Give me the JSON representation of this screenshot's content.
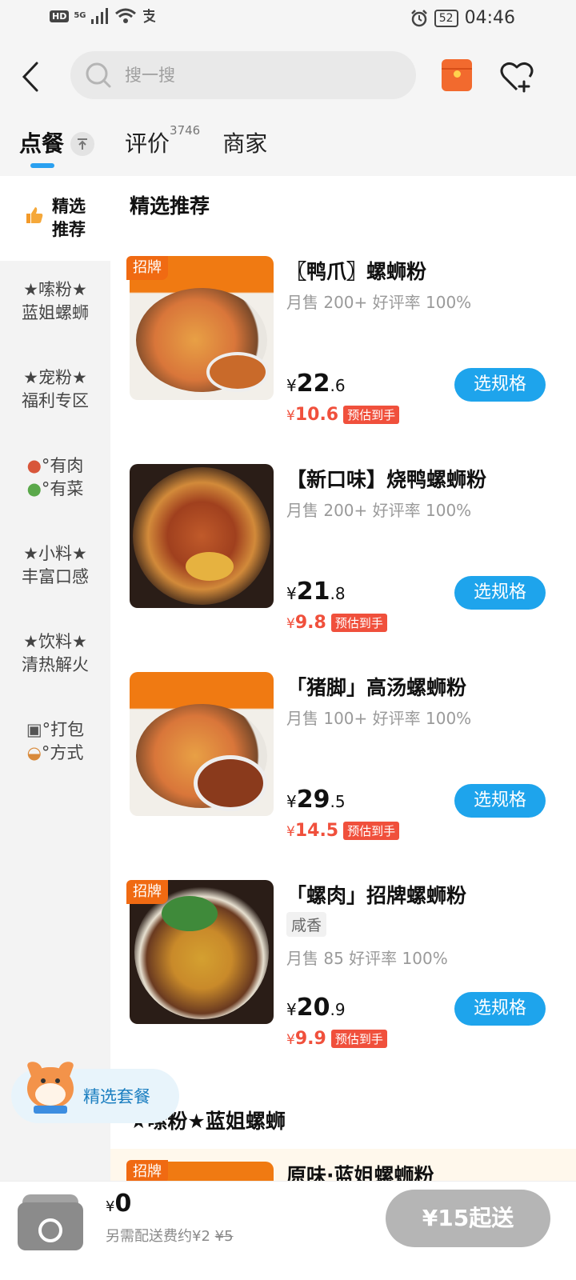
{
  "status_bar": {
    "hd": "HD",
    "network": "5G",
    "battery": "52",
    "time": "04:46"
  },
  "header": {
    "search_placeholder": "搜一搜",
    "tabs": [
      {
        "label": "点餐",
        "active": true
      },
      {
        "label": "评价",
        "count": "3746"
      },
      {
        "label": "商家"
      }
    ]
  },
  "sidebar": {
    "items": [
      {
        "line1": "精选",
        "line2": "推荐",
        "active": true,
        "icon": "thumbs-up-icon"
      },
      {
        "line1": "★嗦粉★",
        "line2": "蓝姐螺蛳"
      },
      {
        "line1": "★宠粉★",
        "line2": "福利专区"
      },
      {
        "line1": "°有肉",
        "line2": "°有菜",
        "icon": "meat-veg-icon"
      },
      {
        "line1": "★小料★",
        "line2": "丰富口感"
      },
      {
        "line1": "★饮料★",
        "line2": "清热解火"
      },
      {
        "line1": "°打包",
        "line2": "°方式",
        "icon": "package-icon"
      }
    ]
  },
  "main": {
    "section1_title": "精选推荐",
    "section2_title": "★嗦粉★蓝姐螺蛳",
    "badge_label": "招牌",
    "spec_button_label": "选规格",
    "est_label": "预估到手",
    "currency": "¥",
    "items": [
      {
        "name": "〖鸭爪〗螺蛳粉",
        "sales": "月售 200+ 好评率 100%",
        "price_int": "22",
        "price_dec": ".6",
        "est": "10.6",
        "badge": true
      },
      {
        "name": "【新口味】烧鸭螺蛳粉",
        "sales": "月售 200+ 好评率 100%",
        "price_int": "21",
        "price_dec": ".8",
        "est": "9.8",
        "badge": false
      },
      {
        "name": "「猪脚」高汤螺蛳粉",
        "sales": "月售 100+ 好评率 100%",
        "price_int": "29",
        "price_dec": ".5",
        "est": "14.5",
        "badge": false
      },
      {
        "name": "「螺肉」招牌螺蛳粉",
        "tag": "咸香",
        "sales": "月售 85 好评率 100%",
        "price_int": "20",
        "price_dec": ".9",
        "est": "9.9",
        "badge": true
      },
      {
        "name": "原味·蓝姐螺蛳粉",
        "badge": true
      }
    ]
  },
  "promo": {
    "label": "精选套餐"
  },
  "cart": {
    "currency": "¥",
    "total": "0",
    "fee_prefix": "另需配送费约¥2",
    "fee_original": "¥5",
    "min_order_label": "¥15起送"
  },
  "colors": {
    "accent_blue": "#1ea4ec",
    "badge_orange": "#f06a12",
    "price_red": "#f0503c"
  }
}
